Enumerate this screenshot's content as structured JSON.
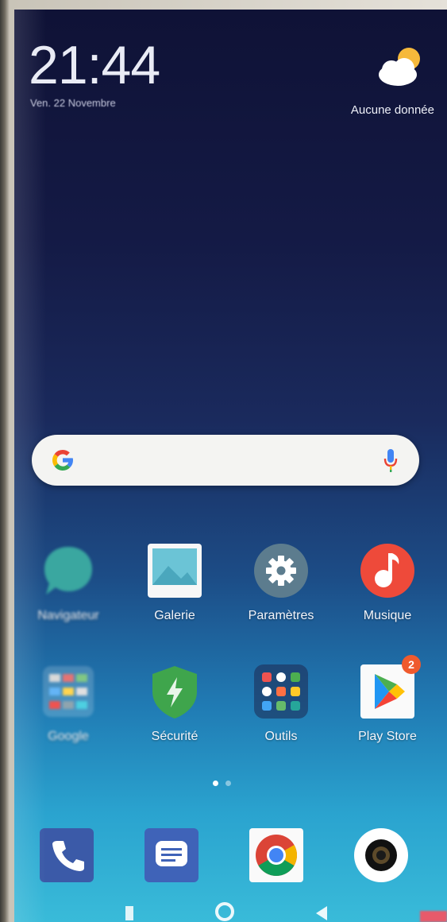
{
  "status": {
    "time": "21:44",
    "date": "Ven. 22 Novembre"
  },
  "weather": {
    "icon": "partly-cloudy-icon",
    "text": "Aucune donnée"
  },
  "search": {
    "logo": "google-g-icon",
    "mic": "mic-icon"
  },
  "apps": {
    "row1": [
      {
        "label": "Navigateur",
        "icon": "browser-icon"
      },
      {
        "label": "Galerie",
        "icon": "gallery-icon"
      },
      {
        "label": "Paramètres",
        "icon": "settings-gear-icon"
      },
      {
        "label": "Musique",
        "icon": "music-icon"
      }
    ],
    "row2": [
      {
        "label": "Google",
        "icon": "google-folder-icon"
      },
      {
        "label": "Sécurité",
        "icon": "security-shield-icon"
      },
      {
        "label": "Outils",
        "icon": "tools-folder-icon"
      },
      {
        "label": "Play Store",
        "icon": "play-store-icon",
        "badge": "2"
      }
    ]
  },
  "page_indicator": {
    "pages": 2,
    "current": 1
  },
  "dock": [
    {
      "name": "phone",
      "icon": "phone-icon"
    },
    {
      "name": "messages",
      "icon": "messages-icon"
    },
    {
      "name": "chrome",
      "icon": "chrome-icon"
    },
    {
      "name": "camera",
      "icon": "camera-icon"
    }
  ],
  "colors": {
    "badge": "#ef5a2d",
    "settings_icon_bg": "#5c7c8e",
    "music_icon_bg": "#ee4a3a",
    "security_icon_bg": "#3fa54c",
    "browser_icon_bg": "#3aa7a0"
  }
}
